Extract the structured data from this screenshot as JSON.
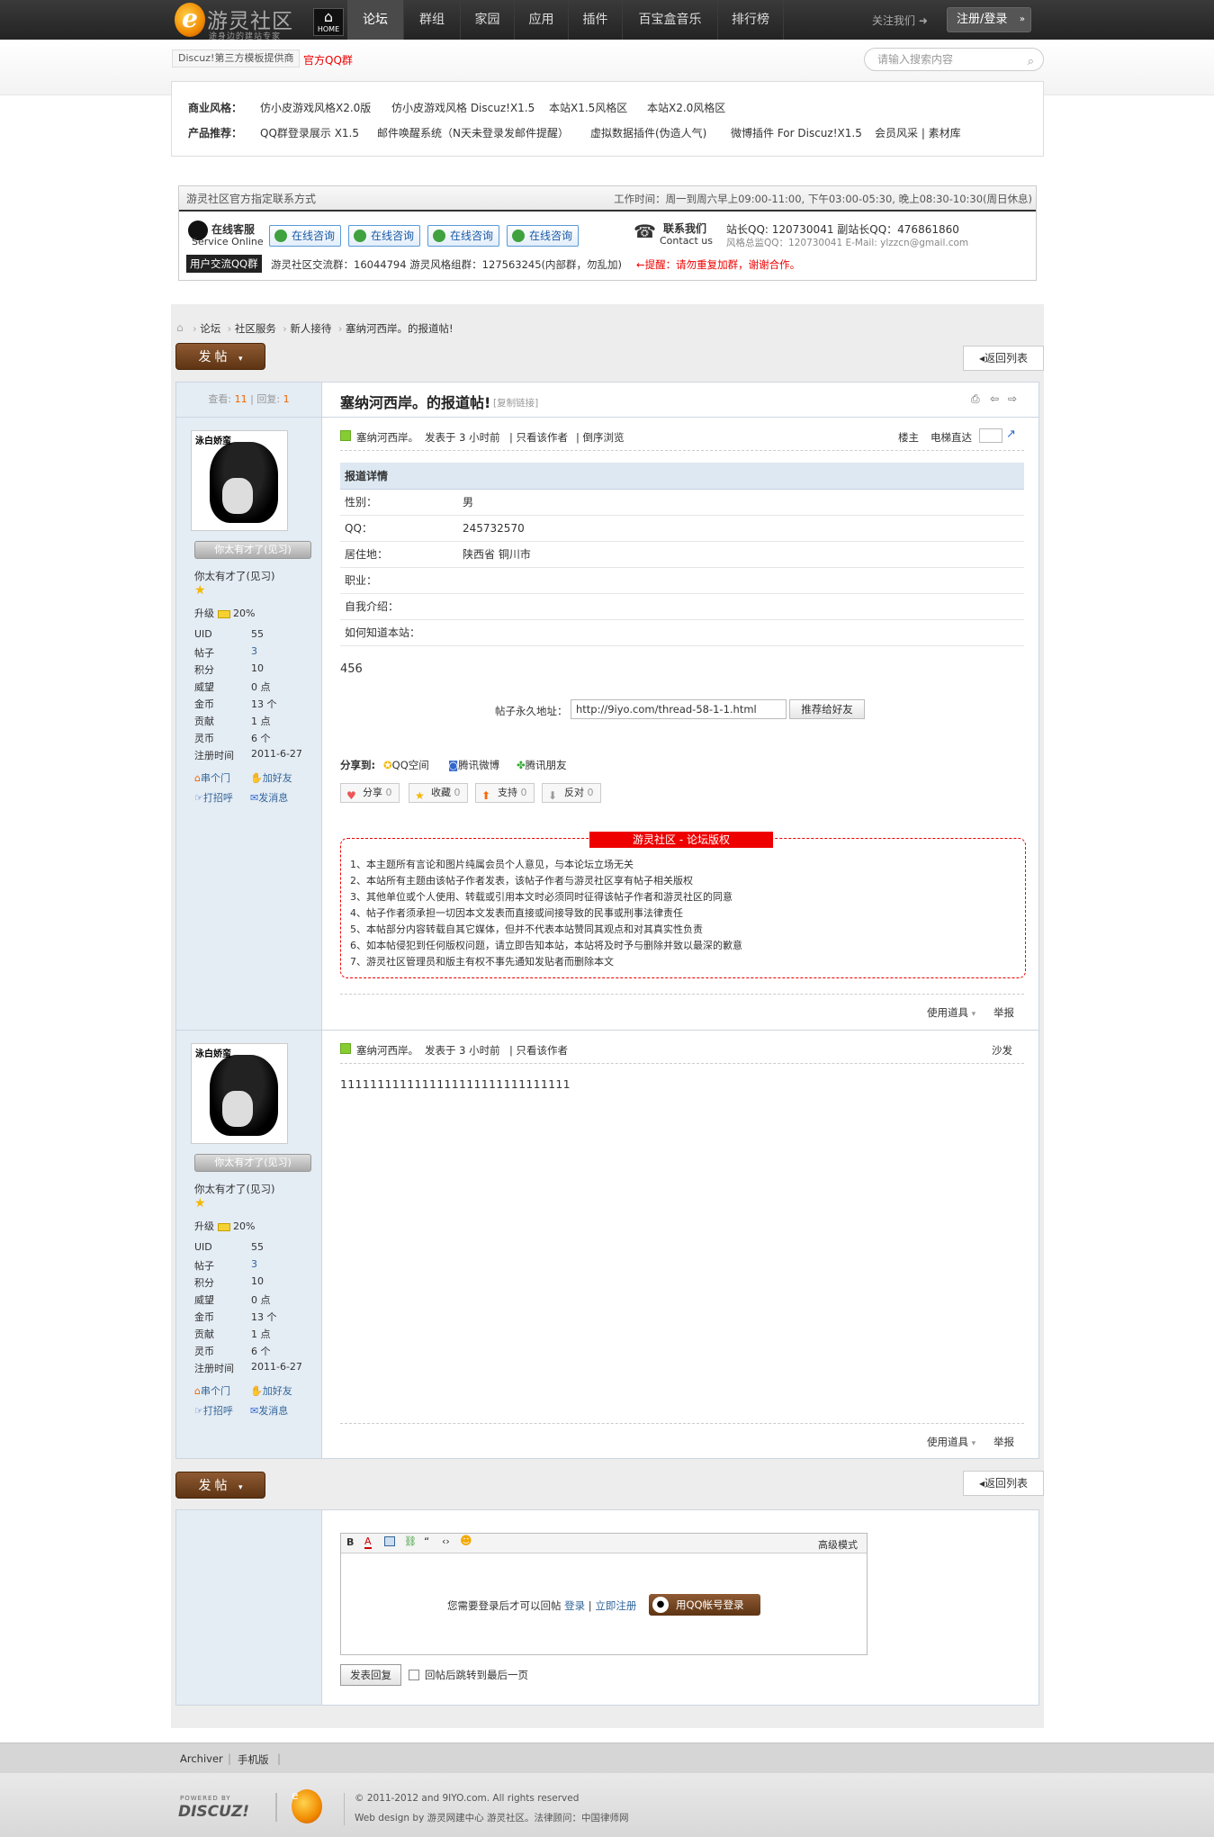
{
  "site": {
    "logo_text": "游灵社区",
    "logo_sub": "途身边的建站专家",
    "home_label": "HOME",
    "nav": [
      "论坛",
      "群组",
      "家园",
      "应用",
      "插件",
      "百宝盒音乐",
      "排行榜"
    ],
    "follow": "关注我们 ➜",
    "login": "注册/登录"
  },
  "subbar": {
    "discuz_link": "Discuz!第三方模板提供商",
    "qq_group": "官方QQ群",
    "search_placeholder": "请输入搜索内容"
  },
  "promo": {
    "row1_label": "商业风格：",
    "row1": [
      "仿小皮游戏风格X2.0版",
      "仿小皮游戏风格 Discuz!X1.5",
      "本站X1.5风格区",
      "本站X2.0风格区"
    ],
    "row2_label": "产品推荐：",
    "row2": [
      "QQ群登录展示 X1.5",
      "邮件唤醒系统（N天未登录发邮件提醒）",
      "虚拟数据插件(伪造人气)",
      "微博插件 For Discuz!X1.5",
      "会员风采 | 素材库"
    ]
  },
  "contact": {
    "title": "游灵社区官方指定联系方式",
    "hours": "工作时间：周一到周六早上09:00-11:00, 下午03:00-05:30, 晚上08:30-10:30(周日休息)",
    "service": "在线客服",
    "service_en": "Service Online",
    "consult": [
      "在线咨询",
      "在线咨询",
      "在线咨询",
      "在线咨询"
    ],
    "contact_label": "联系我们",
    "contact_en": "Contact us",
    "qq_line1": "站长QQ: 120730041   副站长QQ：476861860",
    "qq_line2": "风格总监QQ：120730041    E-Mail: ylzzcn@gmail.com",
    "group_label": "用户交流QQ群",
    "group_text": "游灵社区交流群：16044794    游灵风格组群：127563245(内部群，勿乱加)",
    "warn": "←提醒：请勿重复加群，谢谢合作。"
  },
  "breadcrumb": [
    "论坛",
    "社区服务",
    "新人接待",
    "塞纳河西岸。的报道帖!"
  ],
  "buttons": {
    "post": "发帖",
    "back": "返回列表"
  },
  "thread": {
    "views_label": "查看:",
    "views": "11",
    "replies_label": "回复:",
    "replies": "1",
    "title": "塞纳河西岸。的报道帖!",
    "copy_link": "[复制链接]"
  },
  "user": {
    "avatar_text": "泳白娇蛮",
    "title_badge": "你太有才了(见习)",
    "title": "你太有才了(见习)",
    "upgrade_label": "升级",
    "upgrade": "20%",
    "stats": [
      {
        "k": "UID",
        "v": "55"
      },
      {
        "k": "帖子",
        "v": "3"
      },
      {
        "k": "积分",
        "v": "10"
      },
      {
        "k": "威望",
        "v": "0 点"
      },
      {
        "k": "金币",
        "v": "13 个"
      },
      {
        "k": "贡献",
        "v": "1 点"
      },
      {
        "k": "灵币",
        "v": "6 个"
      },
      {
        "k": "注册时间",
        "v": "2011-6-27"
      }
    ],
    "actions": [
      "串个门",
      "加好友",
      "打招呼",
      "发消息"
    ]
  },
  "post1": {
    "author": "塞纳河西岸。",
    "time": "发表于 3 小时前",
    "only_author": "只看该作者",
    "reverse": "倒序浏览",
    "floor": "楼主",
    "elevator": "电梯直达",
    "detail_title": "报道详情",
    "details": [
      {
        "k": "性别：",
        "v": "男"
      },
      {
        "k": "QQ：",
        "v": "245732570"
      },
      {
        "k": "居住地：",
        "v": "陕西省 铜川市"
      },
      {
        "k": "职业：",
        "v": ""
      },
      {
        "k": "自我介绍：",
        "v": ""
      },
      {
        "k": "如何知道本站：",
        "v": ""
      }
    ],
    "body": "456",
    "perma_label": "帖子永久地址：",
    "perma_url": "http://9iyo.com/thread-58-1-1.html",
    "recommend": "推荐给好友",
    "share_label": "分享到:",
    "share": [
      "QQ空间",
      "腾讯微博",
      "腾讯朋友"
    ],
    "votes": [
      {
        "label": "分享",
        "count": "0"
      },
      {
        "label": "收藏",
        "count": "0"
      },
      {
        "label": "支持",
        "count": "0"
      },
      {
        "label": "反对",
        "count": "0"
      }
    ],
    "copyright_tag": "游灵社区 - 论坛版权",
    "copyright": [
      "1、本主题所有言论和图片纯属会员个人意见，与本论坛立场无关",
      "2、本站所有主题由该帖子作者发表，该帖子作者与游灵社区享有帖子相关版权",
      "3、其他单位或个人使用、转载或引用本文时必须同时征得该帖子作者和游灵社区的同意",
      "4、帖子作者须承担一切因本文发表而直接或间接导致的民事或刑事法律责任",
      "5、本帖部分内容转载自其它媒体，但并不代表本站赞同其观点和对其真实性负责",
      "6、如本帖侵犯到任何版权问题，请立即告知本站，本站将及时予与删除并致以最深的歉意",
      "7、游灵社区管理员和版主有权不事先通知发贴者而删除本文"
    ],
    "tools": "使用道具",
    "report": "举报"
  },
  "post2": {
    "author": "塞纳河西岸。",
    "time": "发表于 3 小时前",
    "only_author": "只看该作者",
    "floor": "沙发",
    "body": "1111111111111111111111111111111",
    "tools": "使用道具",
    "report": "举报"
  },
  "reply": {
    "advanced": "高级模式",
    "need_login": "您需要登录后才可以回帖",
    "login": "登录",
    "register": "立即注册",
    "qq_login": "用QQ帐号登录",
    "submit": "发表回复",
    "jump": "回帖后跳转到最后一页"
  },
  "footer": {
    "links": [
      "Archiver",
      "手机版"
    ],
    "powered": "POWERED BY",
    "discuz": "DISCUZ!",
    "copyright": "© 2011-2012 and 9IYO.com. All rights reserved",
    "design": "Web design by 游灵网建中心 游灵社区。法律顾问：中国律师网"
  }
}
